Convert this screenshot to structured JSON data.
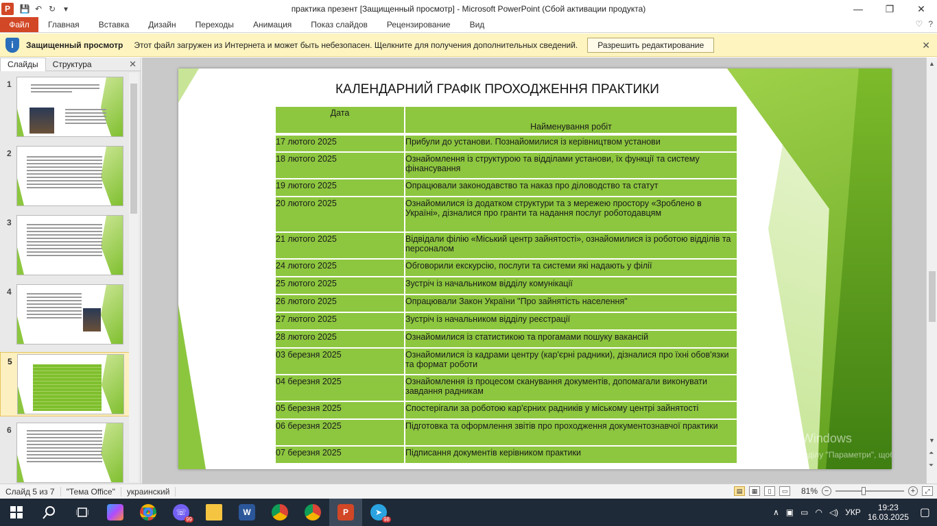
{
  "window": {
    "title": "практика презент [Защищенный просмотр]  -  Microsoft PowerPoint (Сбой активации продукта)",
    "app_letter": "P",
    "minimize": "—",
    "maximize": "❐",
    "close": "✕"
  },
  "qat": {
    "save": "💾",
    "undo": "↶",
    "redo": "↻",
    "more": "▾"
  },
  "ribbon": {
    "file_tab": "Файл",
    "tabs": [
      "Главная",
      "Вставка",
      "Дизайн",
      "Переходы",
      "Анимация",
      "Показ слайдов",
      "Рецензирование",
      "Вид"
    ],
    "right": {
      "expand": "♡",
      "help": "?"
    }
  },
  "protected_view": {
    "title": "Защищенный просмотр",
    "message": "Этот файл загружен из Интернета и может быть небезопасен. Щелкните для получения дополнительных сведений.",
    "button": "Разрешить редактирование",
    "close": "✕",
    "icon_letter": "i"
  },
  "slides_panel": {
    "tab_slides": "Слайды",
    "tab_outline": "Структура",
    "close": "✕",
    "thumbnails": [
      {
        "num": "1",
        "kind": "title"
      },
      {
        "num": "2",
        "kind": "text"
      },
      {
        "num": "3",
        "kind": "text"
      },
      {
        "num": "4",
        "kind": "text-image"
      },
      {
        "num": "5",
        "kind": "table",
        "selected": true
      },
      {
        "num": "6",
        "kind": "text"
      }
    ]
  },
  "slide": {
    "title": "КАЛЕНДАРНИЙ ГРАФІК ПРОХОДЖЕННЯ ПРАКТИКИ",
    "header_date": "Дата",
    "header_work": "Найменування робіт",
    "rows": [
      {
        "date": "17 лютого 2025",
        "work": "Прибули  до установи.  Познайомилися  із керівництвом установи",
        "h": "h26"
      },
      {
        "date": "18 лютого 2025",
        "work": " Ознайомлення  із структурою  та відділами установи,  їх функції та систему фінансування",
        "h": "h39"
      },
      {
        "date": "19 лютого 2025",
        "work": "Опрацювали законодавство та наказ про діловодство та статут",
        "h": "h26"
      },
      {
        "date": "20 лютого 2025",
        "work": "Ознайомилися  із додатком структури  та з мережею простору   «Зроблено в Україні», дізналися про гранти  та надання послуг  роботодавцям",
        "h": "h52"
      },
      {
        "date": "21 лютого 2025",
        "work": "Відвідали  філію «Міський центр  зайнятості», ознайомилися  із роботою  відділів та персоналом",
        "h": "h39"
      },
      {
        "date": "24 лютого 2025",
        "work": "Обговорили  екскурсію,  послуги  та системи  які надають у філії",
        "h": "h26"
      },
      {
        "date": "25 лютого 2025",
        "work": "Зустріч із начальником  відділу комунікації",
        "h": "h26"
      },
      {
        "date": "26 лютого 2025",
        "work": "Опрацювали Закон України \"Про зайнятість населення\"",
        "h": "h26"
      },
      {
        "date": "27 лютого 2025",
        "work": "Зустріч із начальником  відділу реєстрації",
        "h": "h26"
      },
      {
        "date": "28 лютого 2025",
        "work": "Ознайомилися  із статистикою  та прогамами пошуку  вакансій",
        "h": "h26"
      },
      {
        "date": "03 березня  2025",
        "work": "Ознайомилися  із кадрами центру  (кар'єрні радники),  дізналися про їхні обов'язки та формат роботи",
        "h": "h39"
      },
      {
        "date": "04 березня  2025",
        "work": "Ознайомлення  із процесом  сканування  документів, допомагали виконувати  завдання радникам",
        "h": "h39"
      },
      {
        "date": "05 березня  2025",
        "work": "Спостерігали за роботою  кар'єрних радників у  міському центрі  зайнятості",
        "h": "h26"
      },
      {
        "date": "06 березня  2025",
        "work": "Підготовка та оформлення  звітів про проходження документознавчої практики",
        "h": "h39"
      },
      {
        "date": "07 березня  2025",
        "work": "Підписання  документів керівником практики",
        "h": "h26"
      }
    ]
  },
  "activation": {
    "title": "Активація Windows",
    "text": "Перейдіть до розділу \"Параметри\", щоб активувати Windows."
  },
  "statusbar": {
    "slide_info": "Слайд 5 из 7",
    "theme": "\"Тема Office\"",
    "language": "украинский",
    "zoom": "81%",
    "zoom_minus": "−",
    "zoom_plus": "+",
    "zoom_level": 0.81
  },
  "taskbar": {
    "lang": "УКР",
    "time": "19:23",
    "date": "16.03.2025",
    "viber_badge": "99",
    "telegram_badge": "98",
    "word_letter": "W",
    "ppt_letter": "P"
  },
  "colors": {
    "accent": "#d24726",
    "slide_green": "#8dc63f",
    "protbar": "#fdf4bf"
  }
}
